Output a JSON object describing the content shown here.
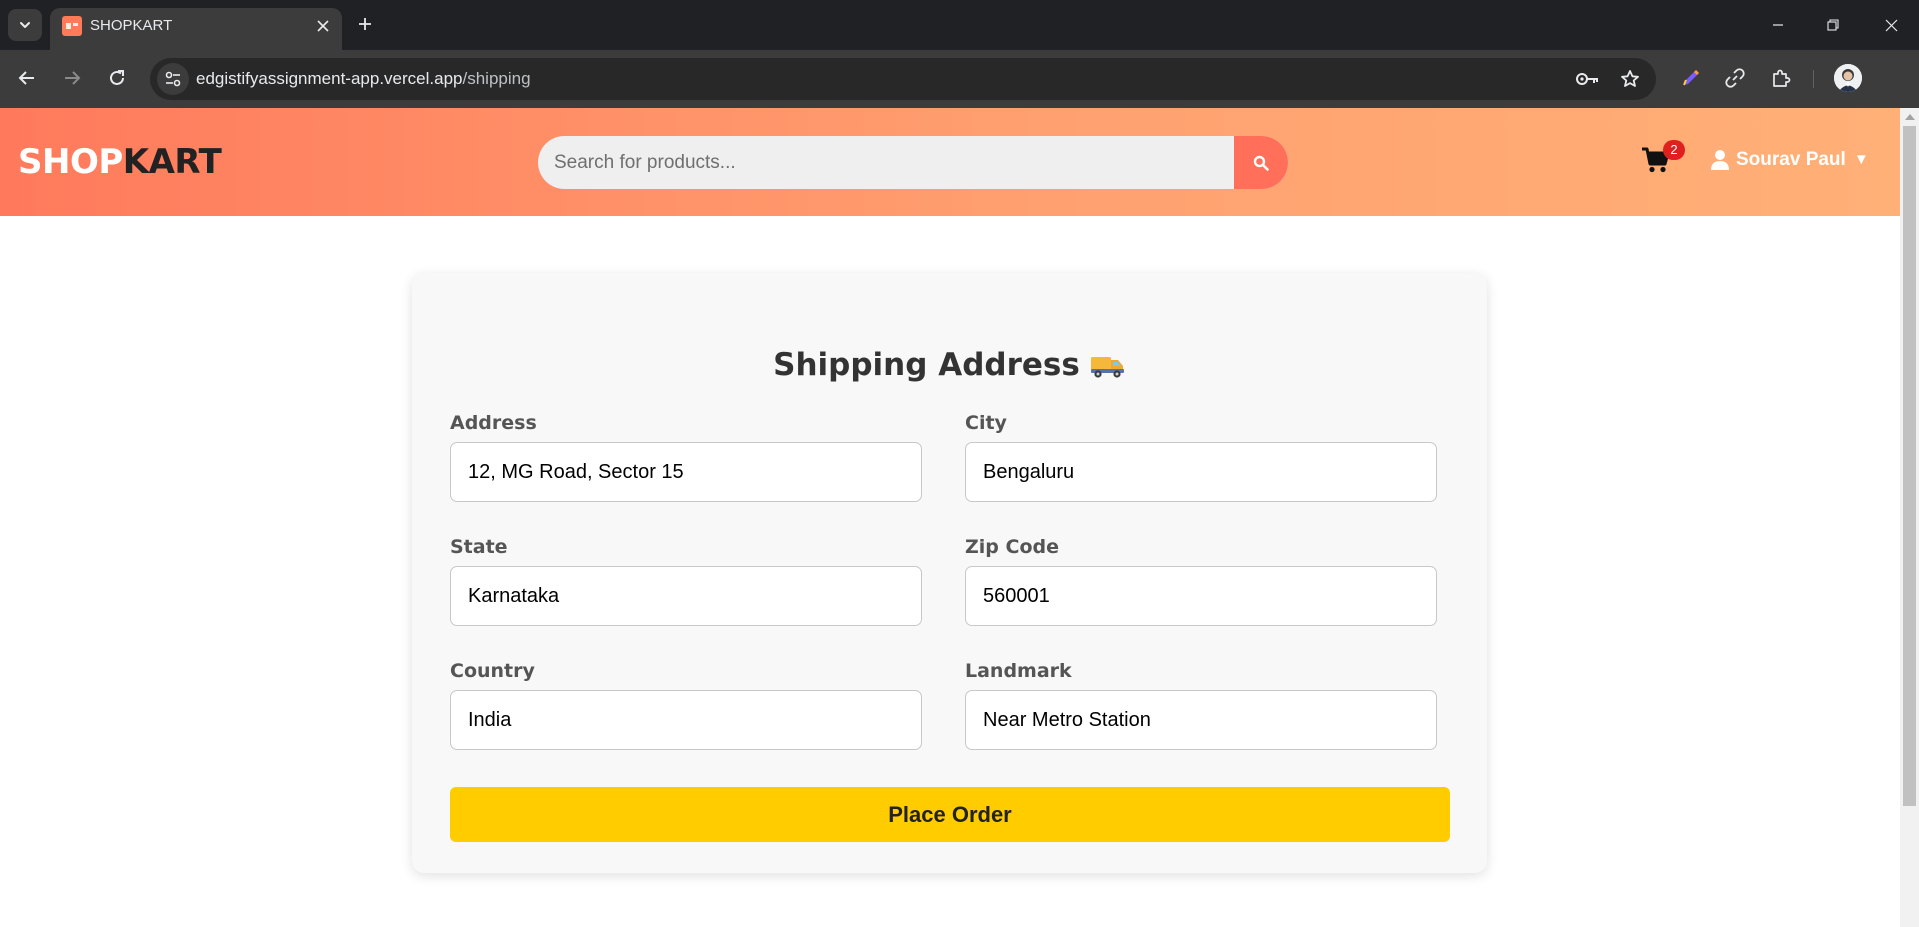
{
  "browser": {
    "tab_title": "SHOPKART",
    "url_host": "edgistifyassignment-app.vercel.app",
    "url_path": "/shipping"
  },
  "header": {
    "logo_part1": "SHOP",
    "logo_part2": "KART",
    "search_placeholder": "Search for products...",
    "cart_count": "2",
    "user_name": "Sourav Paul",
    "user_caret": "▼"
  },
  "shipping": {
    "title": "Shipping Address",
    "fields": {
      "address": {
        "label": "Address",
        "value": "12, MG Road, Sector 15"
      },
      "city": {
        "label": "City",
        "value": "Bengaluru"
      },
      "state": {
        "label": "State",
        "value": "Karnataka"
      },
      "zip": {
        "label": "Zip Code",
        "value": "560001"
      },
      "country": {
        "label": "Country",
        "value": "India"
      },
      "landmark": {
        "label": "Landmark",
        "value": "Near Metro Station"
      }
    },
    "submit_label": "Place Order"
  },
  "icons": {
    "tab_search": "chevron-down-icon",
    "favicon": "shopkart-favicon-icon",
    "close": "close-icon",
    "new_tab": "plus-icon",
    "back": "arrow-left-icon",
    "forward": "arrow-right-icon",
    "reload": "reload-icon",
    "site_info": "tune-icon",
    "password": "key-icon",
    "bookmark": "star-icon",
    "extensions": "puzzle-icon",
    "search": "search-icon",
    "cart": "cart-icon",
    "user": "user-icon",
    "truck": "truck-icon"
  },
  "colors": {
    "header_gradient_start": "#ff7a5c",
    "header_gradient_end": "#ffb077",
    "search_button": "#ff6f59",
    "cart_badge": "#e01f1f",
    "place_order_button": "#ffcc00",
    "card_background": "#f8f8f8"
  }
}
